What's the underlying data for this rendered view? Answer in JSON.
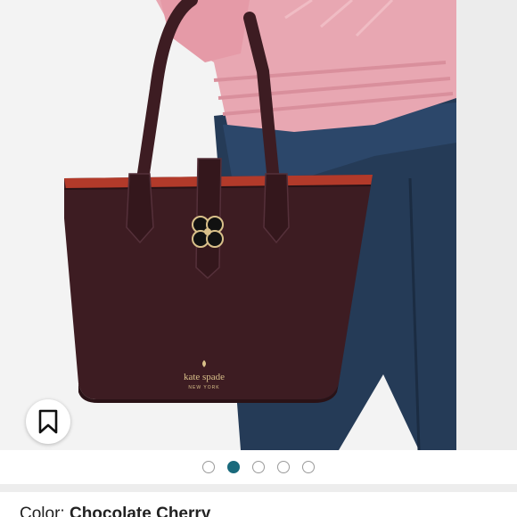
{
  "product": {
    "image_alt": "Kate Spade tote bag photo",
    "brand_mark_line1": "kate spade",
    "brand_mark_line2": "NEW YORK"
  },
  "carousel": {
    "total_slides": 5,
    "active_index": 1
  },
  "color_selector": {
    "label": "Color: ",
    "value": "Chocolate Cherry"
  },
  "colors": {
    "accent": "#1a6a7c",
    "bag": "#3d1c22",
    "lining": "#b23a2a",
    "sweater": "#e8a7b2",
    "jeans": "#253b57"
  },
  "icons": {
    "bookmark": "bookmark-icon"
  }
}
